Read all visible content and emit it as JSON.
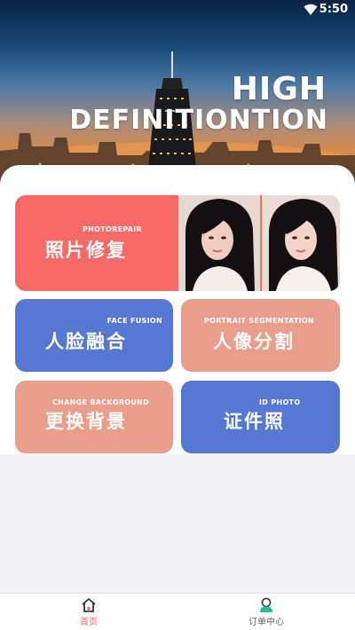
{
  "status_bar": {
    "time": "5:50"
  },
  "hero": {
    "line1": "HIGH",
    "line2": "DEFINITIONTION"
  },
  "tiles": {
    "photo_repair": {
      "sub": "PHOTOREPAIR",
      "main": "照片修复"
    },
    "face_fusion": {
      "sub": "FACE FUSION",
      "main": "人脸融合"
    },
    "portrait_segmentation": {
      "sub": "PORTRAIT SEGMENTATION",
      "main": "人像分割"
    },
    "change_background": {
      "sub": "CHANGE BACKGROUND",
      "main": "更换背景"
    },
    "id_photo": {
      "sub": "ID PHOTO",
      "main": "证件照"
    }
  },
  "bottom_nav": {
    "home": {
      "label": "首页",
      "icon": "home-icon",
      "active": true
    },
    "orders": {
      "label": "订单中心",
      "icon": "user-icon",
      "active": false
    }
  },
  "colors": {
    "accent": "#f86a67",
    "blue_tile": "#5678d3",
    "peach_tile": "#e89e8a",
    "nav_active": "#f86a67",
    "nav_orders_icon": "#1fbf9a"
  }
}
